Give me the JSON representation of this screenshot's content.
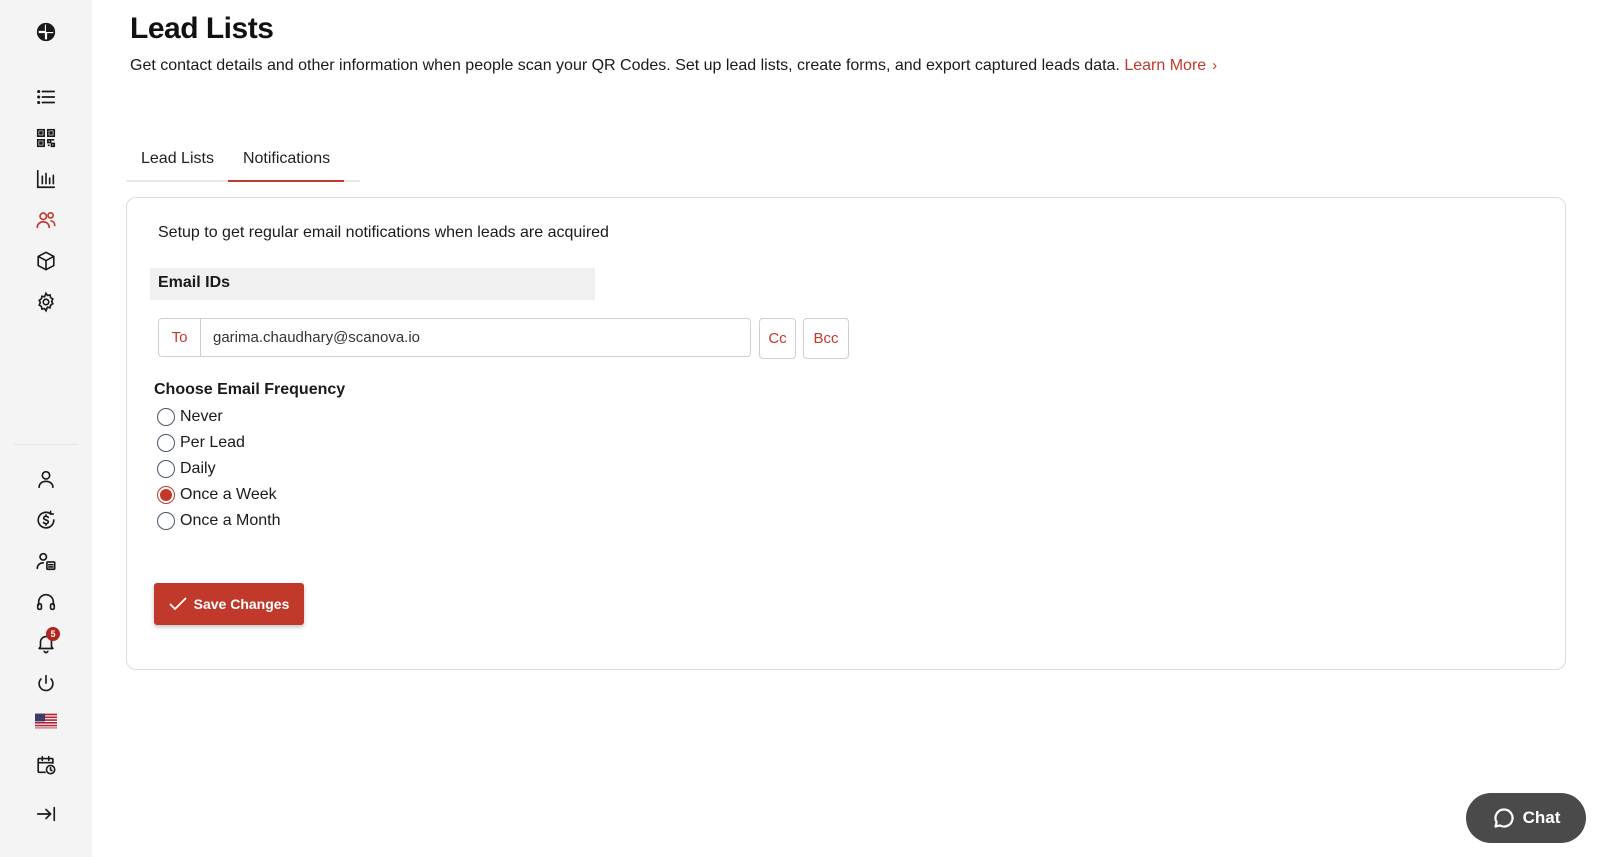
{
  "sidebar": {
    "top_icons": [
      "brand-logo-icon",
      "list-icon",
      "qr-code-icon",
      "bar-chart-icon",
      "users-icon",
      "box-icon",
      "settings-icon"
    ],
    "bottom_icons": [
      "user-icon",
      "billing-icon",
      "user-card-icon",
      "headset-icon",
      "bell-icon",
      "power-icon",
      "us-flag-icon",
      "calendar-clock-icon",
      "collapse-icon"
    ],
    "active_icon": "users-icon",
    "notification_count": "5",
    "accent": "#c0392b"
  },
  "header": {
    "title": "Lead Lists",
    "subtitle": "Get contact details and other information when people scan your QR Codes. Set up lead lists, create forms, and export captured leads data.",
    "learn_more": "Learn More"
  },
  "tabs": [
    {
      "label": "Lead Lists",
      "active": false
    },
    {
      "label": "Notifications",
      "active": true
    }
  ],
  "notifications": {
    "intro": "Setup to get regular email notifications when leads are acquired",
    "email_ids_header": "Email IDs",
    "to_label": "To",
    "to_value": "garima.chaudhary@scanova.io",
    "cc_label": "Cc",
    "bcc_label": "Bcc",
    "frequency_label": "Choose Email Frequency",
    "frequency_options": [
      {
        "label": "Never",
        "checked": false
      },
      {
        "label": "Per Lead",
        "checked": false
      },
      {
        "label": "Daily",
        "checked": false
      },
      {
        "label": "Once a Week",
        "checked": true
      },
      {
        "label": "Once a Month",
        "checked": false
      }
    ],
    "save_label": "Save Changes"
  },
  "chat": {
    "label": "Chat"
  }
}
